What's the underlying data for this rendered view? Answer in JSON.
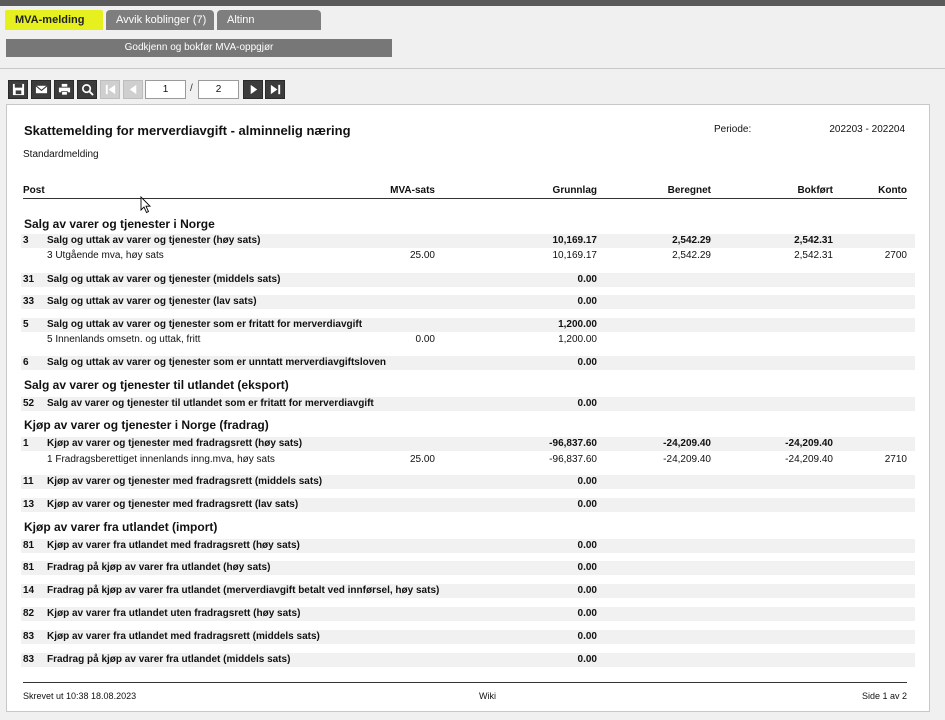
{
  "tabs": [
    {
      "label": "MVA-melding",
      "active": true
    },
    {
      "label": "Avvik koblinger (7)",
      "active": false
    },
    {
      "label": "Altinn",
      "active": false
    }
  ],
  "approve_button": "Godkjenn og bokfør MVA-oppgjør",
  "toolbar": {
    "icons": [
      "save-icon",
      "mail-icon",
      "print-icon",
      "search-icon",
      "first-page-icon",
      "prev-page-icon",
      "next-page-icon",
      "last-page-icon"
    ],
    "current_page": "1",
    "separator": "/",
    "total_pages": "2"
  },
  "report": {
    "title": "Skattemelding for merverdiavgift - alminnelig næring",
    "subtitle": "Standardmelding",
    "periode_label": "Periode:",
    "periode_value": "202203 - 202204",
    "columns": {
      "post": "Post",
      "sats": "MVA-sats",
      "grunnlag": "Grunnlag",
      "beregnet": "Beregnet",
      "bokfort": "Bokført",
      "konto": "Konto"
    },
    "sections": [
      {
        "title": "Salg av varer og tjenester i Norge"
      },
      {
        "title": "Salg av varer og tjenester til utlandet (eksport)"
      },
      {
        "title": "Kjøp av varer og tjenester i Norge (fradrag)"
      },
      {
        "title": "Kjøp av varer fra utlandet (import)"
      }
    ],
    "rows": [
      {
        "post": "3",
        "text": "Salg og uttak av varer og tjenester (høy sats)",
        "sats": "",
        "grunnlag": "10,169.17",
        "beregnet": "2,542.29",
        "bokfort": "2,542.31",
        "konto": ""
      },
      {
        "post": "",
        "text": "3 Utgående mva, høy sats",
        "sats": "25.00",
        "grunnlag": "10,169.17",
        "beregnet": "2,542.29",
        "bokfort": "2,542.31",
        "konto": "2700"
      },
      {
        "post": "31",
        "text": "Salg og uttak av varer og tjenester (middels sats)",
        "sats": "",
        "grunnlag": "0.00",
        "beregnet": "",
        "bokfort": "",
        "konto": ""
      },
      {
        "post": "33",
        "text": "Salg og uttak av varer og tjenester (lav sats)",
        "sats": "",
        "grunnlag": "0.00",
        "beregnet": "",
        "bokfort": "",
        "konto": ""
      },
      {
        "post": "5",
        "text": "Salg og uttak av varer og tjenester som er fritatt for merverdiavgift",
        "sats": "",
        "grunnlag": "1,200.00",
        "beregnet": "",
        "bokfort": "",
        "konto": ""
      },
      {
        "post": "",
        "text": "5 Innenlands omsetn. og uttak, fritt",
        "sats": "0.00",
        "grunnlag": "1,200.00",
        "beregnet": "",
        "bokfort": "",
        "konto": ""
      },
      {
        "post": "6",
        "text": "Salg og uttak av varer og tjenester som er unntatt merverdiavgiftsloven",
        "sats": "",
        "grunnlag": "0.00",
        "beregnet": "",
        "bokfort": "",
        "konto": ""
      },
      {
        "post": "52",
        "text": "Salg av varer og tjenester til utlandet som er fritatt for merverdiavgift",
        "sats": "",
        "grunnlag": "0.00",
        "beregnet": "",
        "bokfort": "",
        "konto": ""
      },
      {
        "post": "1",
        "text": "Kjøp av varer og tjenester med fradragsrett (høy sats)",
        "sats": "",
        "grunnlag": "-96,837.60",
        "beregnet": "-24,209.40",
        "bokfort": "-24,209.40",
        "konto": ""
      },
      {
        "post": "",
        "text": "1 Fradragsberettiget innenlands inng.mva, høy sats",
        "sats": "25.00",
        "grunnlag": "-96,837.60",
        "beregnet": "-24,209.40",
        "bokfort": "-24,209.40",
        "konto": "2710"
      },
      {
        "post": "11",
        "text": "Kjøp av varer og tjenester med fradragsrett (middels sats)",
        "sats": "",
        "grunnlag": "0.00",
        "beregnet": "",
        "bokfort": "",
        "konto": ""
      },
      {
        "post": "13",
        "text": "Kjøp av varer og tjenester med fradragsrett (lav sats)",
        "sats": "",
        "grunnlag": "0.00",
        "beregnet": "",
        "bokfort": "",
        "konto": ""
      },
      {
        "post": "81",
        "text": "Kjøp av varer fra utlandet med fradragsrett (høy sats)",
        "sats": "",
        "grunnlag": "0.00",
        "beregnet": "",
        "bokfort": "",
        "konto": ""
      },
      {
        "post": "81",
        "text": "Fradrag på kjøp av varer fra utlandet (høy sats)",
        "sats": "",
        "grunnlag": "0.00",
        "beregnet": "",
        "bokfort": "",
        "konto": ""
      },
      {
        "post": "14",
        "text": "Fradrag på kjøp av varer fra utlandet (merverdiavgift betalt ved innførsel, høy sats)",
        "sats": "",
        "grunnlag": "0.00",
        "beregnet": "",
        "bokfort": "",
        "konto": ""
      },
      {
        "post": "82",
        "text": "Kjøp av varer fra utlandet uten fradragsrett (høy sats)",
        "sats": "",
        "grunnlag": "0.00",
        "beregnet": "",
        "bokfort": "",
        "konto": ""
      },
      {
        "post": "83",
        "text": "Kjøp av varer fra utlandet med fradragsrett (middels sats)",
        "sats": "",
        "grunnlag": "0.00",
        "beregnet": "",
        "bokfort": "",
        "konto": ""
      },
      {
        "post": "83",
        "text": "Fradrag på kjøp av varer fra utlandet (middels sats)",
        "sats": "",
        "grunnlag": "0.00",
        "beregnet": "",
        "bokfort": "",
        "konto": ""
      }
    ],
    "footer": {
      "printed": "Skrevet ut 10:38 18.08.2023",
      "center": "Wiki",
      "page": "Side 1 av 2"
    }
  },
  "colors": {
    "active_tab": "#e6f01e",
    "tab": "#7e7e7e",
    "toolbar_button": "#3c3c3c"
  }
}
